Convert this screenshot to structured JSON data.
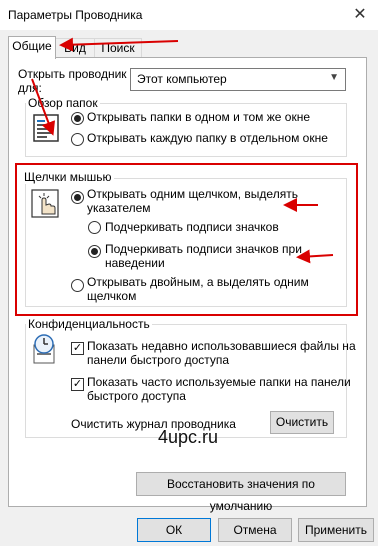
{
  "window": {
    "title": "Параметры Проводника",
    "close_glyph": "✕"
  },
  "tabs": [
    {
      "label": "Общие",
      "active": true
    },
    {
      "label": "Вид",
      "active": false
    },
    {
      "label": "Поиск",
      "active": false
    }
  ],
  "open_explorer": {
    "label_line1": "Открыть проводник",
    "label_line2": "для:",
    "value": "Этот компьютер"
  },
  "browse_folders": {
    "title": "Обзор папок",
    "options": [
      {
        "label": "Открывать папки в одном и том же окне",
        "selected": true
      },
      {
        "label": "Открывать каждую папку в отдельном окне",
        "selected": false
      }
    ]
  },
  "mouse_clicks": {
    "title": "Щелчки мышью",
    "single_click": {
      "line1": "Открывать одним щелчком, выделять",
      "line2": "указателем",
      "selected": true
    },
    "underline_always": {
      "label": "Подчеркивать подписи значков",
      "selected": false
    },
    "underline_hover": {
      "line1": "Подчеркивать подписи значков при",
      "line2": "наведении",
      "selected": true
    },
    "double_click": {
      "line1": "Открывать двойным, а выделять одним",
      "line2": "щелчком",
      "selected": false
    }
  },
  "privacy": {
    "title": "Конфиденциальность",
    "recent_files": {
      "line1": "Показать недавно использовавшиеся файлы на",
      "line2": "панели быстрого доступа",
      "checked": true
    },
    "frequent_folders": {
      "line1": "Показать часто используемые папки на панели",
      "line2": "быстрого доступа",
      "checked": true
    },
    "clear_label": "Очистить журнал проводника",
    "clear_button": "Очистить"
  },
  "watermark": "4upc.ru",
  "restore_defaults": "Восстановить значения по умолчанию",
  "footer": {
    "ok": "ОК",
    "cancel": "Отмена",
    "apply": "Применить"
  },
  "annotation_color": "#d90000",
  "icons": [
    "folder-window-icon",
    "mouse-click-icon",
    "privacy-clock-icon",
    "dropdown-arrow-icon",
    "close-icon"
  ]
}
